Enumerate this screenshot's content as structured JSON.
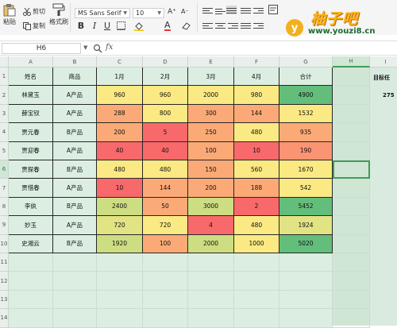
{
  "ribbon": {
    "cut_label": "剪切",
    "copy_label": "复制",
    "paste_label": "粘贴",
    "format_painter_label": "格式刷",
    "font_name": "MS Sans Serif",
    "font_size": "10",
    "bold": "B",
    "italic": "I",
    "underline": "U",
    "increase_font": "A⁺",
    "decrease_font": "A⁻",
    "font_color_glyph": "A",
    "icons": [
      "cut-icon",
      "copy-icon",
      "paste-icon",
      "format-painter-icon",
      "border-icon",
      "fill-color-icon",
      "font-color-icon",
      "align-top-icon",
      "align-middle-icon",
      "align-bottom-icon",
      "align-left-icon",
      "align-center-icon",
      "align-right-icon"
    ]
  },
  "watermark": {
    "badge": "y",
    "title": "柚子吧",
    "url": "www.youzi8.cn"
  },
  "formula_bar": {
    "name_box": "H6",
    "fx": "fx",
    "value": ""
  },
  "sheet": {
    "columns": [
      "A",
      "B",
      "C",
      "D",
      "E",
      "F",
      "G",
      "H",
      "I"
    ],
    "active_column": "H",
    "active_row": "6",
    "rows": [
      "1",
      "2",
      "3",
      "4",
      "5",
      "6",
      "7",
      "8",
      "9",
      "10",
      "11",
      "12",
      "13",
      "14"
    ],
    "headers": [
      "姓名",
      "商品",
      "1月",
      "2月",
      "3月",
      "4月",
      "合计"
    ],
    "side_header": "目标任",
    "side_value": "275",
    "data": [
      {
        "name": "林黛玉",
        "product": "A产品",
        "m1": "960",
        "m2": "960",
        "m3": "2000",
        "m4": "980",
        "total": "4900"
      },
      {
        "name": "薛宝钗",
        "product": "A产品",
        "m1": "288",
        "m2": "800",
        "m3": "300",
        "m4": "144",
        "total": "1532"
      },
      {
        "name": "贾元春",
        "product": "B产品",
        "m1": "200",
        "m2": "5",
        "m3": "250",
        "m4": "480",
        "total": "935"
      },
      {
        "name": "贾迎春",
        "product": "A产品",
        "m1": "40",
        "m2": "40",
        "m3": "100",
        "m4": "10",
        "total": "190"
      },
      {
        "name": "贾探春",
        "product": "B产品",
        "m1": "480",
        "m2": "480",
        "m3": "150",
        "m4": "560",
        "total": "1670"
      },
      {
        "name": "贾惜春",
        "product": "A产品",
        "m1": "10",
        "m2": "144",
        "m3": "200",
        "m4": "188",
        "total": "542"
      },
      {
        "name": "李纨",
        "product": "B产品",
        "m1": "2400",
        "m2": "50",
        "m3": "3000",
        "m4": "2",
        "total": "5452"
      },
      {
        "name": "妙玉",
        "product": "A产品",
        "m1": "720",
        "m2": "720",
        "m3": "4",
        "m4": "480",
        "total": "1924"
      },
      {
        "name": "史湘云",
        "product": "B产品",
        "m1": "1920",
        "m2": "100",
        "m3": "2000",
        "m4": "1000",
        "total": "5020"
      }
    ],
    "cell_colors": [
      [
        "#fbe983",
        "#fbe983",
        "#fbe983",
        "#fbe983",
        "#63be7b"
      ],
      [
        "#fbaa77",
        "#fbe983",
        "#fbaa77",
        "#fbaa77",
        "#fbe983"
      ],
      [
        "#fbaa77",
        "#f8696b",
        "#fbaa77",
        "#fbe983",
        "#fbaa77"
      ],
      [
        "#f8696b",
        "#f8696b",
        "#fbaa77",
        "#f8696b",
        "#fa9473"
      ],
      [
        "#fbe983",
        "#fbe983",
        "#fbaa77",
        "#fbe983",
        "#fbe983"
      ],
      [
        "#f8696b",
        "#fbaa77",
        "#fbaa77",
        "#fbaa77",
        "#fbe983"
      ],
      [
        "#cddd82",
        "#fbaa77",
        "#cddd82",
        "#f8696b",
        "#63be7b"
      ],
      [
        "#e2e383",
        "#fbe983",
        "#f8696b",
        "#fbe983",
        "#e2e383"
      ],
      [
        "#cddd82",
        "#fbaa77",
        "#cddd82",
        "#fbe983",
        "#63be7b"
      ]
    ]
  }
}
